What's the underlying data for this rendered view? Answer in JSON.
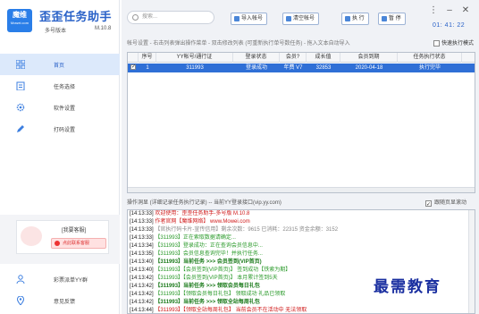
{
  "app": {
    "logo_text": "魔维",
    "logo_sub": "Mowei.com",
    "title": "歪歪任务助手",
    "subtitle": "多号版本",
    "version": "M.10.8"
  },
  "sidebar": {
    "items": [
      {
        "label": "首页",
        "icon": "grid-icon"
      },
      {
        "label": "任务选择",
        "icon": "clipboard-icon"
      },
      {
        "label": "软件设置",
        "icon": "gear-icon"
      },
      {
        "label": "打码设置",
        "icon": "pencil-icon"
      }
    ],
    "support": {
      "title": "[我要客服]",
      "button": "点此联系客服"
    },
    "bottom_items": [
      {
        "label": "彩票派单YY群",
        "icon": "user-icon"
      },
      {
        "label": "意见反馈",
        "icon": "location-icon"
      }
    ]
  },
  "toolbar": {
    "search_placeholder": "搜索...",
    "import_label": "导入帐号",
    "clear_label": "清空帐号",
    "run_label": "执 行",
    "pause_label": "暂 停",
    "clock": "01: 41: 22"
  },
  "accounts": {
    "hint": "帐号设置 - 右击列表弹出操作菜单 - 双击修改列表 (可重新执行单号数任务) - 拖入文本自动导入",
    "fast_mode_label": "快速执行模式",
    "columns": [
      "序号",
      "YY帐号/通行证",
      "登录状态",
      "会员?",
      "成长值",
      "会员到期",
      "任务执行状态"
    ],
    "rows": [
      {
        "no": "1",
        "account": "311993",
        "status": "登录成功",
        "vip": "年费 V7",
        "growth": "32853",
        "expire": "2020-04-18",
        "task": "执行完毕"
      }
    ]
  },
  "log": {
    "header": "操作洞显 (详细记录任务执行记录) -- 当前YY登录接口(vip.yy.com)",
    "auto_scroll_label": "跟随页显滚动",
    "lines": [
      {
        "ts": "[14:13:33]",
        "text": "欢迎使用：歪歪任务助手-多号版 M.10.8",
        "color": "#d01818"
      },
      {
        "ts": "[14:13:33]",
        "text": "作者官网【魔维网络】 www.Mowei.com",
        "color": "#d01818"
      },
      {
        "ts": "[14:13:33]",
        "text": "【官执行码卡片-宣传信用】剩余次数：9615  已消耗：22315  资金余额：3152",
        "color": "#888888"
      },
      {
        "ts": "[14:13:33]",
        "text": "【311993】正在索取数据请确定...",
        "color": "#2a9a2a"
      },
      {
        "ts": "[14:13:34]",
        "text": "【311993】登录成功：正在查询会员信息中...",
        "color": "#2a9a2a"
      },
      {
        "ts": "[14:13:35]",
        "text": "【311993】会员信息查询完毕！并执行任务...",
        "color": "#2a9a2a"
      },
      {
        "ts": "[14:13:40]",
        "text": "【311993】当前任务 >>> 会员签到(VIP首页)",
        "color": "#1a7a1a",
        "bold": true
      },
      {
        "ts": "[14:13:40]",
        "text": "【311993】【会员签到(VIP首页)】 签到成功【铁索为期】",
        "color": "#2a9a2a"
      },
      {
        "ts": "[14:13:42]",
        "text": "【311993】【会员签到(VIP首页)】 本月累计签到5天",
        "color": "#2a9a2a"
      },
      {
        "ts": "[14:13:42]",
        "text": "【311993】当前任务 >>> 领取会员每日礼包",
        "color": "#1a7a1a",
        "bold": true
      },
      {
        "ts": "[14:13:42]",
        "text": "【311993】【领取会员每日礼包】 领取成功 礼品已领取",
        "color": "#2a9a2a"
      },
      {
        "ts": "[14:13:42]",
        "text": "【311993】当前任务 >>> 领取全站每周礼包",
        "color": "#1a7a1a",
        "bold": true
      },
      {
        "ts": "[14:13:44]",
        "text": "【311993】【领取全站每周礼包】 当前会员不在活动中 无法领取",
        "color": "#d01818"
      }
    ]
  },
  "watermark": "最需教育"
}
